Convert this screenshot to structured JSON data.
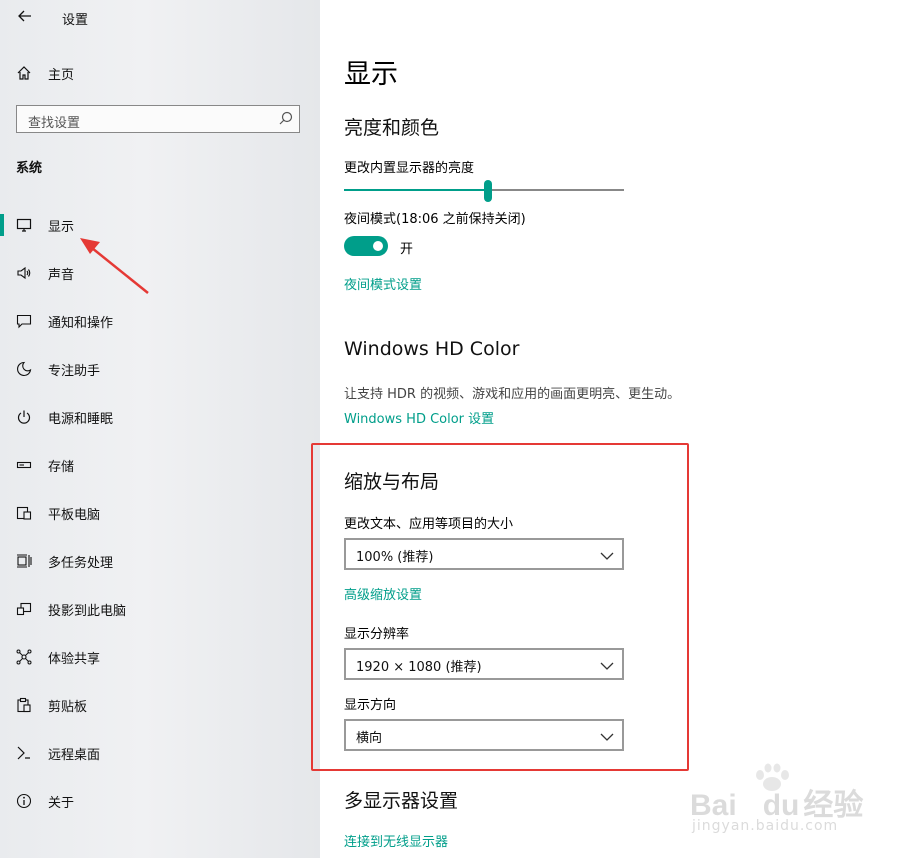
{
  "window": {
    "back_icon": "back-arrow-icon",
    "title": "设置"
  },
  "sidebar": {
    "home": {
      "label": "主页",
      "icon": "home-icon"
    },
    "search": {
      "placeholder": "查找设置",
      "icon": "search-icon"
    },
    "section_title": "系统",
    "items": [
      {
        "label": "显示",
        "icon": "monitor-icon",
        "selected": true
      },
      {
        "label": "声音",
        "icon": "speaker-icon"
      },
      {
        "label": "通知和操作",
        "icon": "message-icon"
      },
      {
        "label": "专注助手",
        "icon": "moon-icon"
      },
      {
        "label": "电源和睡眠",
        "icon": "power-icon"
      },
      {
        "label": "存储",
        "icon": "storage-icon"
      },
      {
        "label": "平板电脑",
        "icon": "tablet-icon"
      },
      {
        "label": "多任务处理",
        "icon": "multitask-icon"
      },
      {
        "label": "投影到此电脑",
        "icon": "project-icon"
      },
      {
        "label": "体验共享",
        "icon": "share-icon"
      },
      {
        "label": "剪贴板",
        "icon": "clipboard-icon"
      },
      {
        "label": "远程桌面",
        "icon": "remote-icon"
      },
      {
        "label": "关于",
        "icon": "info-icon"
      }
    ]
  },
  "main": {
    "page_title": "显示",
    "brightness": {
      "heading": "亮度和颜色",
      "slider_label": "更改内置显示器的亮度",
      "level_fraction": 0.52,
      "night_light_label": "夜间模式(18:06 之前保持关闭)",
      "toggle_state": "开",
      "night_light_link": "夜间模式设置"
    },
    "hdr": {
      "heading": "Windows HD Color",
      "description": "让支持 HDR 的视频、游戏和应用的画面更明亮、更生动。",
      "link": "Windows HD Color 设置"
    },
    "scale": {
      "heading": "缩放与布局",
      "size_label": "更改文本、应用等项目的大小",
      "size_value": "100% (推荐)",
      "advanced_link": "高级缩放设置",
      "resolution_label": "显示分辨率",
      "resolution_value": "1920 × 1080 (推荐)",
      "orientation_label": "显示方向",
      "orientation_value": "横向"
    },
    "multi": {
      "heading": "多显示器设置",
      "link": "连接到无线显示器"
    }
  },
  "watermark": {
    "brand": "Bai",
    "brand_suffix": "du",
    "brand_cn": "经验",
    "url": "jingyan.baidu.com"
  },
  "colors": {
    "accent": "#009e8a",
    "annotation": "#e53935"
  }
}
